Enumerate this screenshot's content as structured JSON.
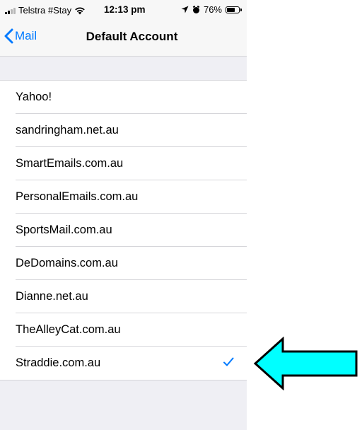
{
  "status_bar": {
    "carrier": "Telstra #Stay",
    "time": "12:13 pm",
    "battery": "76%",
    "battery_level": 0.76
  },
  "nav": {
    "back_label": "Mail",
    "title": "Default Account"
  },
  "accounts": [
    {
      "label": "Yahoo!",
      "selected": false
    },
    {
      "label": "sandringham.net.au",
      "selected": false
    },
    {
      "label": "SmartEmails.com.au",
      "selected": false
    },
    {
      "label": "PersonalEmails.com.au",
      "selected": false
    },
    {
      "label": "SportsMail.com.au",
      "selected": false
    },
    {
      "label": "DeDomains.com.au",
      "selected": false
    },
    {
      "label": "Dianne.net.au",
      "selected": false
    },
    {
      "label": "TheAlleyCat.com.au",
      "selected": false
    },
    {
      "label": "Straddie.com.au",
      "selected": true
    }
  ],
  "colors": {
    "accent": "#007aff",
    "annotation_arrow": "#00ffff"
  },
  "icons": {
    "back": "chevron-left-icon",
    "selected": "checkmark-icon",
    "annotation": "left-arrow-icon"
  }
}
